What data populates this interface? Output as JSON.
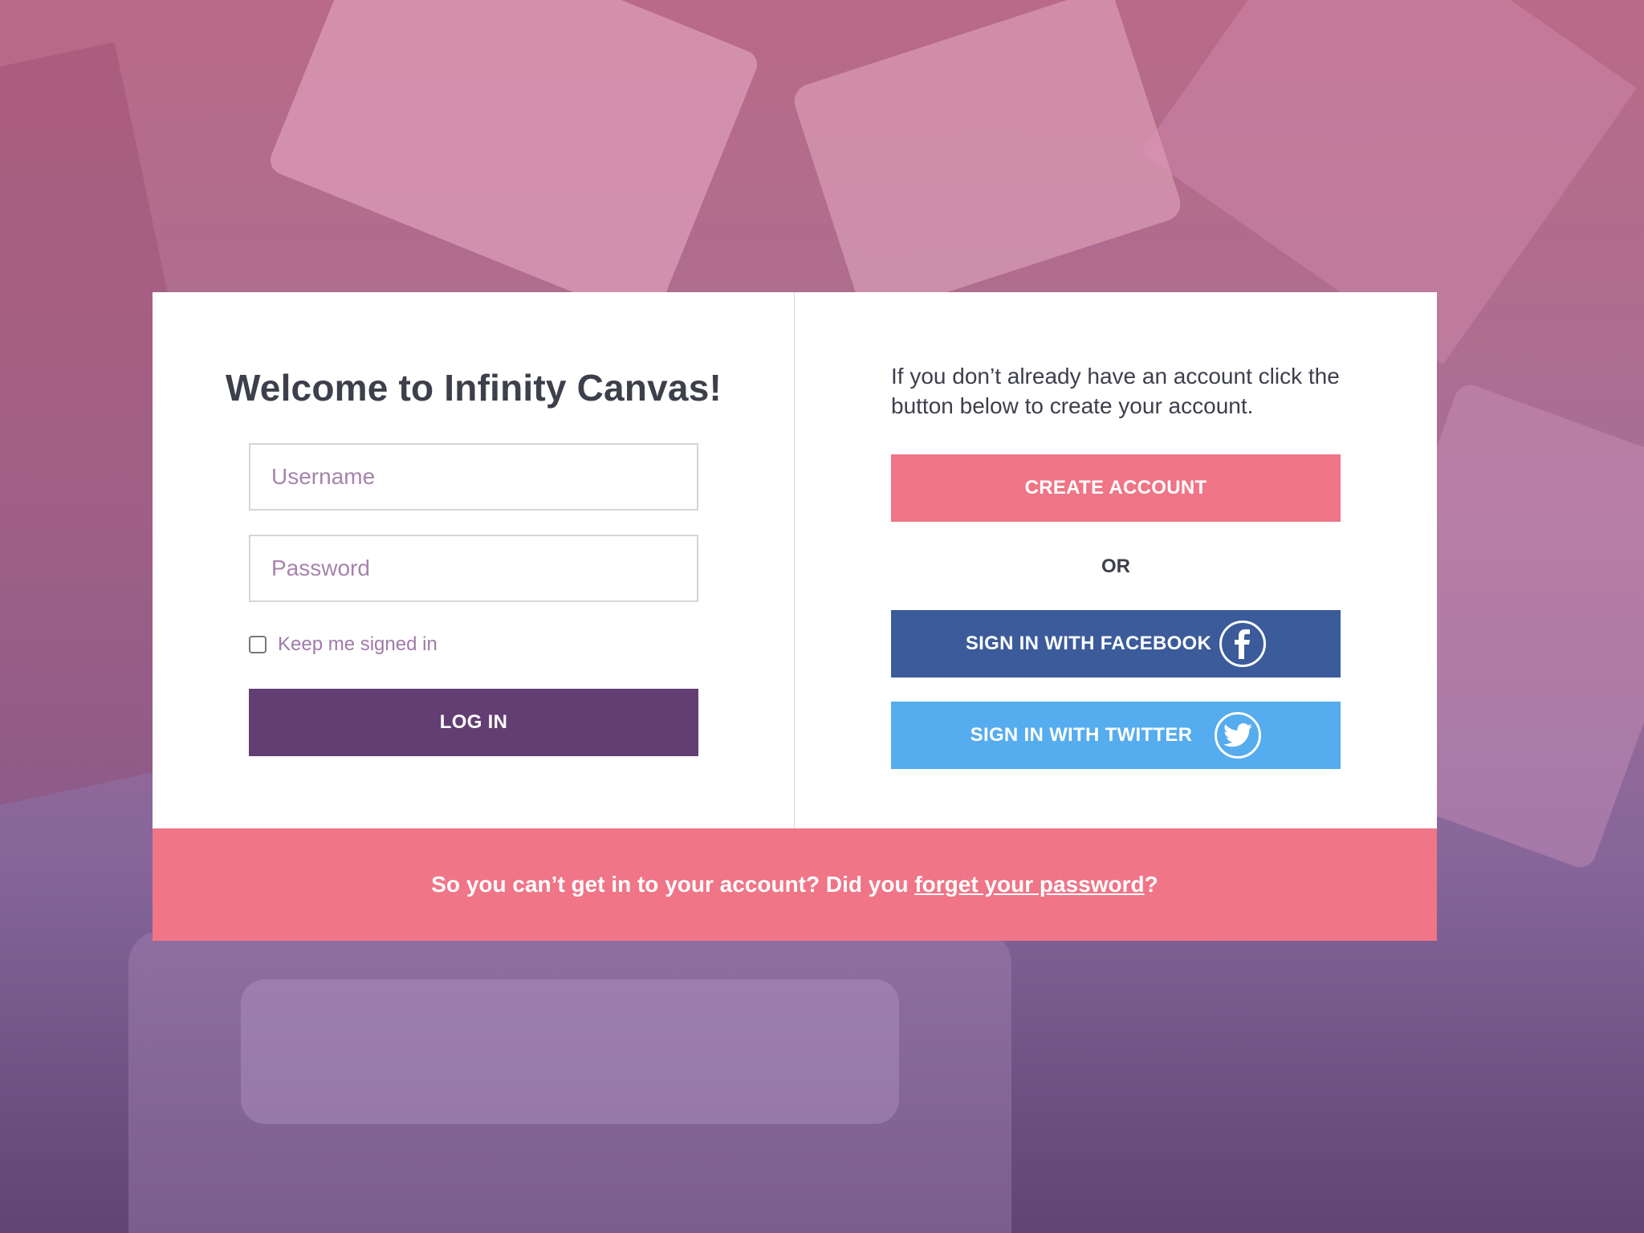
{
  "login": {
    "title": "Welcome to Infinity Canvas!",
    "username_placeholder": "Username",
    "password_placeholder": "Password",
    "keep_signed_in_label": "Keep me signed in",
    "login_button": "LOG IN"
  },
  "signup": {
    "intro": "If you don’t already have an account click the button below to create your account.",
    "create_account_button": "CREATE ACCOUNT",
    "or_label": "OR",
    "facebook_button": "SIGN IN WITH FACEBOOK",
    "twitter_button": "SIGN IN WITH TWITTER"
  },
  "footer": {
    "prefix": "So you can’t get in to your account? Did you ",
    "link": "forget your password",
    "suffix": "?"
  },
  "icons": {
    "facebook": "facebook-icon",
    "twitter": "twitter-icon"
  },
  "colors": {
    "primary_purple": "#623e73",
    "accent_pink": "#ef7587",
    "facebook_blue": "#3b5b9b",
    "twitter_blue": "#55acee",
    "text_dark": "#3d3f4b",
    "placeholder_purple": "#a783ad"
  }
}
